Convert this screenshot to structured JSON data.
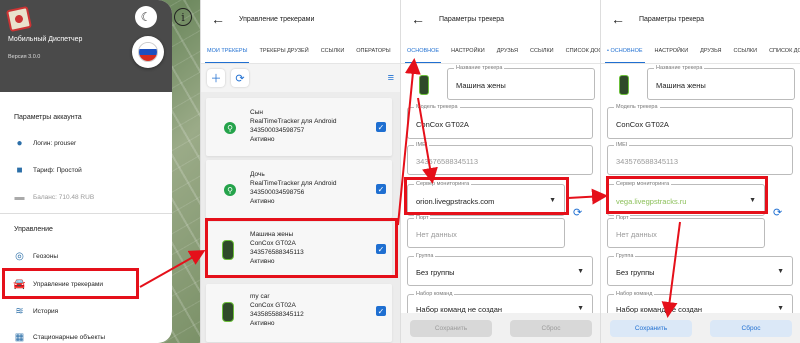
{
  "panel1": {
    "app_title": "Мобильный Диспетчер",
    "version": "Версия 3.0.0",
    "account_section": "Параметры аккаунта",
    "login": "Логин: prouser",
    "tariff": "Тариф: Простой",
    "balance": "Баланс: 710.48 RUB",
    "manage_section": "Управление",
    "menu": [
      "Геозоны",
      "Управление трекерами",
      "История",
      "Стационарные объекты"
    ],
    "icons": [
      "moon-icon",
      "info-icon",
      "person-icon",
      "briefcase-icon",
      "wallet-icon",
      "geofence-icon",
      "car-icon",
      "history-icon",
      "building-icon"
    ]
  },
  "panel2": {
    "title": "Управление трекерами",
    "tabs": [
      "Мои трекеры",
      "Трекеры друзей",
      "Ссылки",
      "Операторы",
      "На"
    ],
    "trackers": [
      {
        "name": "Сын",
        "model": "RealTimeTracker для Android",
        "imei": "343500034598757",
        "status": "Активно"
      },
      {
        "name": "Дочь",
        "model": "RealTimeTracker для Android",
        "imei": "343500034598756",
        "status": "Активно"
      },
      {
        "name": "Машина жены",
        "model": "ConCox GT02A",
        "imei": "343576588345113",
        "status": "Активно"
      },
      {
        "name": "my car",
        "model": "ConCox GT02A",
        "imei": "343585588345112",
        "status": "Активно"
      }
    ]
  },
  "panel3": {
    "title": "Параметры трекера",
    "tabs": [
      "Основное",
      "Настройки",
      "Друзья",
      "Ссылки",
      "Список дос"
    ],
    "name_label": "Название трекера",
    "name_value": "Машина жены",
    "model_label": "Модель трекера",
    "model_value": "ConCox GT02A",
    "imei_label": "IMEI",
    "imei_value": "343576588345113",
    "server_label": "Сервер мониторинга",
    "server_value": "orion.livegpstracks.com",
    "port_label": "Порт",
    "port_value": "Нет данных",
    "group_label": "Группа",
    "group_value": "Без группы",
    "cmd_label": "Набор команд",
    "cmd_value": "Набор команд не создан",
    "save": "Сохранить",
    "reset": "Сброс"
  },
  "panel4": {
    "title": "Параметры трекера",
    "tabs": [
      "• Основное",
      "Настройки",
      "Друзья",
      "Ссылки",
      "Список дос"
    ],
    "name_label": "Название трекера",
    "name_value": "Машина жены",
    "model_label": "Модель трекера",
    "model_value": "ConCox GT02A",
    "imei_label": "IMEI",
    "imei_value": "343576588345113",
    "server_label": "Сервер мониторинга",
    "server_value": "vega.livegpstracks.ru",
    "port_label": "Порт",
    "port_value": "Нет данных",
    "group_label": "Группа",
    "group_value": "Без группы",
    "cmd_label": "Набор команд",
    "cmd_value": "Набор команд не создан",
    "save": "Сохранить",
    "reset": "Сброс"
  },
  "colors": {
    "accent": "#1f6fd1",
    "highlight": "#e5101a",
    "server_new": "#8cc05a"
  }
}
